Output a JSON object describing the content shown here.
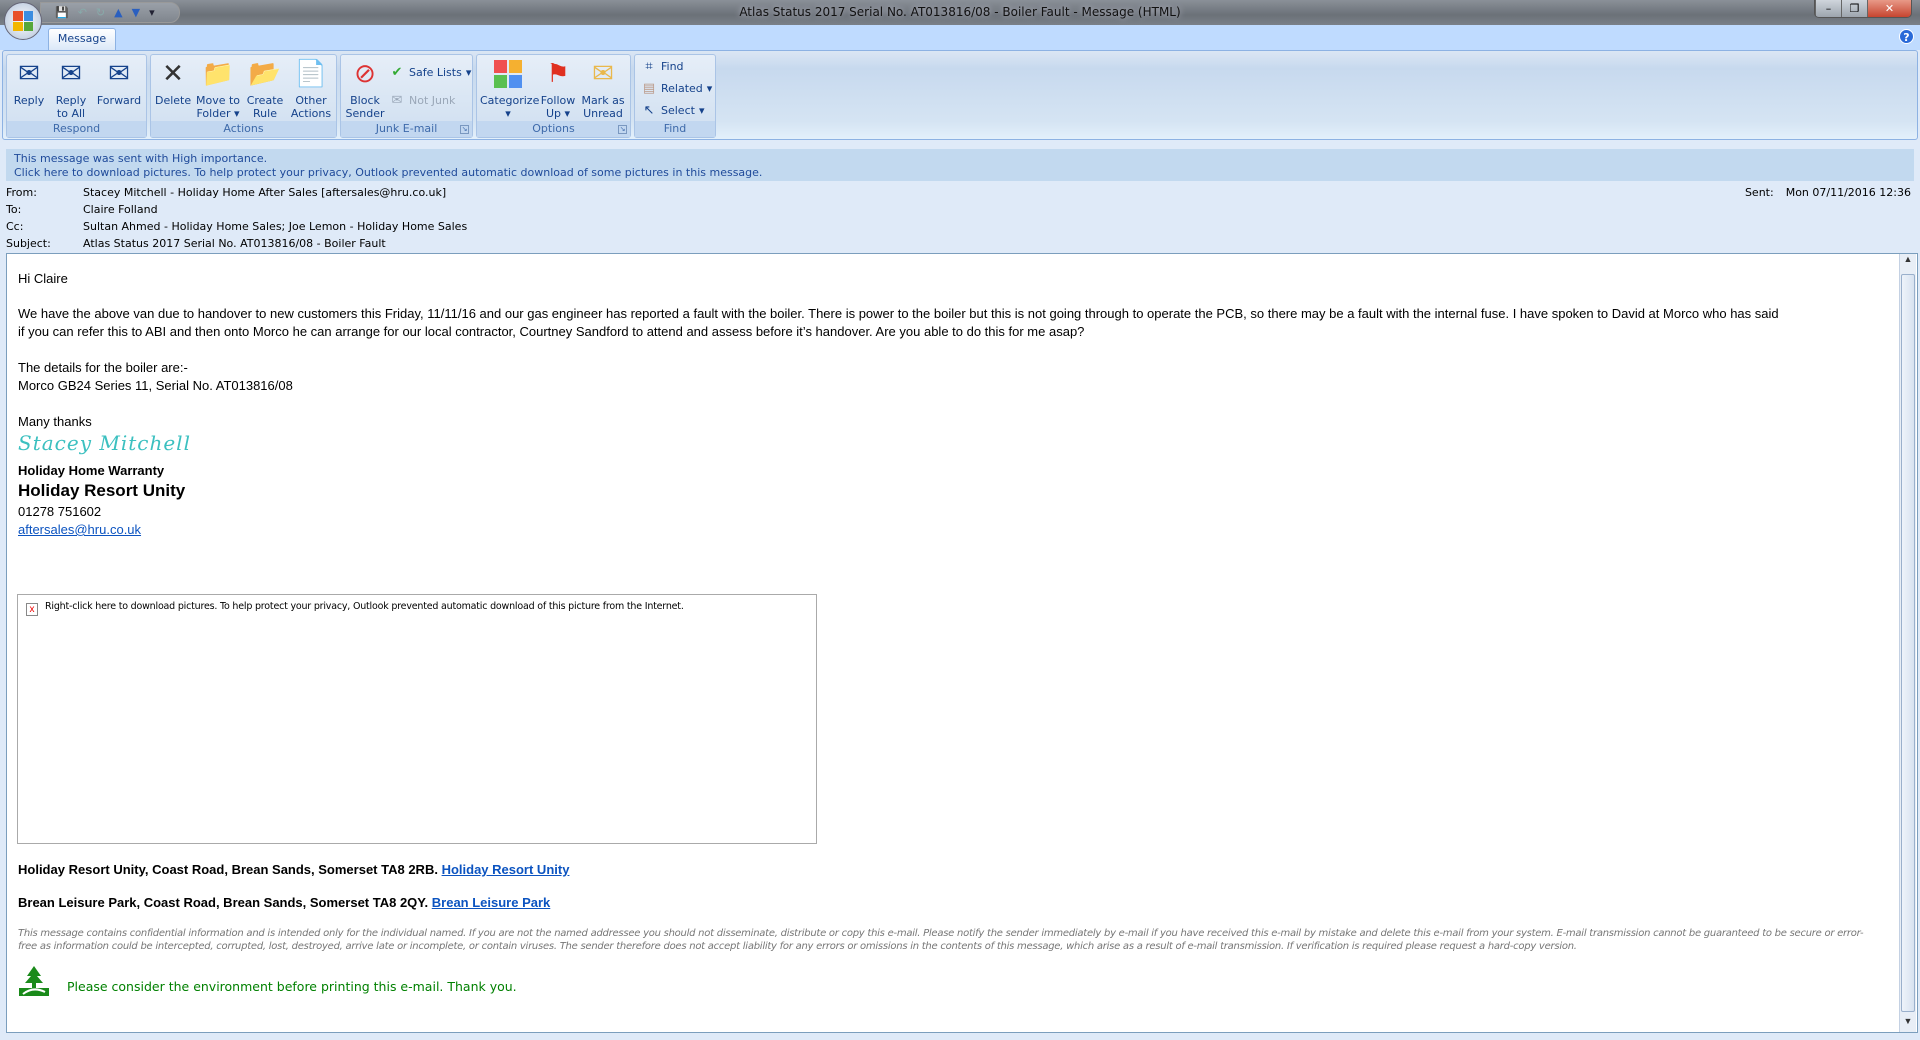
{
  "window": {
    "title": "Atlas Status 2017 Serial No. AT013816/08 - Boiler Fault - Message (HTML)"
  },
  "tabs": [
    {
      "label": "Message"
    }
  ],
  "ribbon": {
    "respond": {
      "label": "Respond",
      "reply": "Reply",
      "reply_all": "Reply to All",
      "forward": "Forward"
    },
    "actions": {
      "label": "Actions",
      "delete": "Delete",
      "move": "Move to Folder",
      "create_rule": "Create Rule",
      "other": "Other Actions"
    },
    "junk": {
      "label": "Junk E-mail",
      "block": "Block Sender",
      "safe": "Safe Lists",
      "notjunk": "Not Junk"
    },
    "options": {
      "label": "Options",
      "categorize": "Categorize",
      "follow": "Follow Up",
      "mark": "Mark as Unread"
    },
    "find": {
      "label": "Find",
      "find": "Find",
      "related": "Related",
      "select": "Select"
    }
  },
  "infobar": {
    "line1": "This message was sent with High importance.",
    "line2": "Click here to download pictures. To help protect your privacy, Outlook prevented automatic download of some pictures in this message."
  },
  "header": {
    "from_label": "From:",
    "from": "Stacey Mitchell - Holiday Home After Sales [aftersales@hru.co.uk]",
    "to_label": "To:",
    "to": "Claire Folland",
    "cc_label": "Cc:",
    "cc": "Sultan Ahmed - Holiday Home Sales; Joe Lemon - Holiday Home Sales",
    "subject_label": "Subject:",
    "subject": "Atlas Status 2017 Serial No. AT013816/08 - Boiler Fault",
    "sent_label": "Sent:",
    "sent": "Mon 07/11/2016 12:36"
  },
  "body": {
    "greeting": "Hi Claire",
    "para1_line1": "We have the above van due to handover to new customers this Friday, 11/11/16 and our gas engineer has reported a fault with the boiler. There is power to the boiler but this is not going through to operate the PCB, so there may be a fault with the internal fuse. I have spoken to David at Morco who has said",
    "para1_line2": "if you can refer this to ABI and then onto Morco he can arrange for our local contractor, Courtney Sandford to attend and assess before it’s handover. Are you able to do this for me asap?",
    "details1": "The details for the boiler are:-",
    "details2": "Morco GB24 Series 11, Serial No. AT013816/08",
    "thanks": "Many thanks",
    "signature": "Stacey Mitchell",
    "sig_dept": "Holiday Home Warranty",
    "sig_company": "Holiday Resort Unity",
    "sig_phone": "01278 751602",
    "sig_email": "aftersales@hru.co.uk",
    "image_blocked": "Right-click here to download pictures.  To help protect your privacy, Outlook prevented automatic download of this picture from the Internet.",
    "address1": "Holiday Resort Unity, Coast Road, Brean Sands, Somerset TA8 2RB.",
    "address1_link": "Holiday Resort Unity",
    "address2": "Brean Leisure Park, Coast Road, Brean Sands, Somerset TA8 2QY.",
    "address2_link": "Brean Leisure Park",
    "disclaimer": "This message contains confidential information and is intended only for the individual named. If you are not the named addressee you should not disseminate, distribute or copy this e-mail. Please notify the sender immediately by e-mail if you have received this e-mail by mistake and delete this e-mail from your system. E-mail transmission cannot be guaranteed to be secure or error-free as information could be intercepted, corrupted, lost, destroyed, arrive late or incomplete, or contain viruses. The sender therefore does not accept liability for any errors or omissions in the contents of this message, which arise as a result of e-mail transmission. If verification is required please request a hard-copy version.",
    "environment": "Please consider the environment before printing this e-mail. Thank you."
  }
}
